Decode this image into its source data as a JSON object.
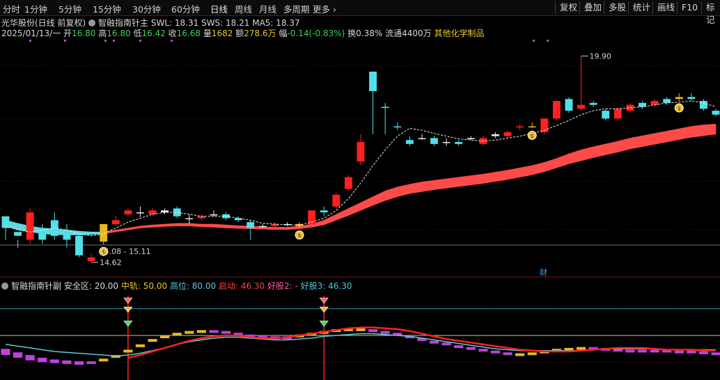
{
  "toolbar": {
    "periods": [
      "分时",
      "1分钟",
      "5分钟",
      "15分钟",
      "30分钟",
      "60分钟",
      "日线",
      "周线",
      "月线",
      "多周期",
      "更多"
    ],
    "active_period": "日线",
    "right_buttons": [
      "复权",
      "叠加",
      "多股",
      "统计",
      "画线",
      "F10",
      "标记"
    ]
  },
  "header": {
    "stock_name": "光华股份(日线 前复权)",
    "indicator_name": "智融指南针主",
    "swl": "SWL: 18.31",
    "sws": "SWS: 18.21",
    "ma5": "MA5: 18.37",
    "date": "2025/01/13/一",
    "open_label": "开",
    "open": "16.80",
    "high_label": "高",
    "high": "16.80",
    "low_label": "低",
    "low": "16.42",
    "close_label": "收",
    "close": "16.68",
    "volume_label": "量",
    "volume": "1682",
    "amount_label": "额",
    "amount": "278.6万",
    "change_label": "幅",
    "change": "-0.14(-0.83%)",
    "turnover": "换0.38%",
    "float_shares": "流通4400万",
    "industry": "其他化学制品"
  },
  "sub_header": {
    "indicator_name": "智融指南针副",
    "safe_zone": "安全区: 20.00",
    "mid_rail": "中轨: 50.00",
    "high_pos": "高位: 80.00",
    "start": "启动: 46.30",
    "good1": "好股2: -",
    "good2": "好股3: 46.30"
  },
  "annotations": {
    "high_marker": "19.90",
    "low_marker": "14.62",
    "range_label": "15.08 - 15.11",
    "finance_tag": "财"
  },
  "colors": {
    "up": "#ff2020",
    "down": "#4fe0e8",
    "band_up": "#ff4a4a",
    "band_down": "#5fd8e0",
    "gold": "#e8b820",
    "purple": "#c040e0",
    "background": "#000000"
  },
  "chart_data": [
    {
      "type": "candlestick",
      "ylim": [
        14.3,
        20.3
      ],
      "candles": [
        [
          15.5,
          15.8,
          15.2,
          15.6,
          "down"
        ],
        [
          15.4,
          15.3,
          15.0,
          15.2,
          "down"
        ],
        [
          15.9,
          15.2,
          15.1,
          16.0,
          "up"
        ],
        [
          15.5,
          15.2,
          15.1,
          15.6,
          "down"
        ],
        [
          15.7,
          15.3,
          15.2,
          15.9,
          "down"
        ],
        [
          15.4,
          15.2,
          15.0,
          15.6,
          "down"
        ],
        [
          15.3,
          14.8,
          14.75,
          15.35,
          "down"
        ],
        [
          14.75,
          14.65,
          14.62,
          14.85,
          "up"
        ],
        [
          15.15,
          15.6,
          15.08,
          15.6,
          "up"
        ],
        [
          15.6,
          15.7,
          15.55,
          15.8,
          "up"
        ],
        [
          15.85,
          15.95,
          15.8,
          16.0,
          "up"
        ],
        [
          15.88,
          15.9,
          15.78,
          16.05,
          "flat"
        ],
        [
          15.95,
          15.85,
          15.8,
          16.0,
          "up"
        ],
        [
          15.95,
          15.9,
          15.85,
          16.0,
          "flat"
        ],
        [
          16.0,
          15.8,
          15.75,
          16.05,
          "down"
        ],
        [
          15.75,
          15.75,
          15.6,
          15.85,
          "flat"
        ],
        [
          15.8,
          15.75,
          15.7,
          15.85,
          "up"
        ],
        [
          15.85,
          15.85,
          15.8,
          15.95,
          "flat"
        ],
        [
          15.85,
          15.75,
          15.7,
          15.9,
          "down"
        ],
        [
          15.75,
          15.7,
          15.65,
          15.8,
          "down"
        ],
        [
          15.65,
          15.5,
          15.2,
          15.7,
          "down"
        ],
        [
          15.55,
          15.55,
          15.5,
          15.6,
          "flat"
        ],
        [
          15.55,
          15.6,
          15.5,
          15.65,
          "up"
        ],
        [
          15.6,
          15.6,
          15.55,
          15.65,
          "flat"
        ],
        [
          15.6,
          15.55,
          15.5,
          15.65,
          "flat"
        ],
        [
          15.6,
          15.95,
          15.5,
          15.95,
          "up"
        ],
        [
          15.9,
          15.95,
          15.8,
          16.05,
          "down"
        ],
        [
          16.05,
          16.35,
          16.0,
          16.4,
          "up"
        ],
        [
          16.5,
          16.8,
          16.45,
          16.85,
          "up"
        ],
        [
          17.2,
          17.7,
          17.1,
          17.9,
          "up"
        ],
        [
          19.0,
          19.5,
          17.9,
          19.5,
          "down"
        ],
        [
          18.6,
          18.6,
          17.9,
          18.7,
          "down"
        ],
        [
          18.1,
          18.1,
          18.0,
          18.2,
          "down"
        ],
        [
          17.75,
          17.65,
          17.6,
          17.85,
          "down"
        ],
        [
          17.8,
          17.8,
          17.75,
          17.9,
          "flat"
        ],
        [
          17.8,
          17.65,
          17.6,
          17.85,
          "down"
        ],
        [
          17.7,
          17.7,
          17.6,
          17.8,
          "flat"
        ],
        [
          17.7,
          17.65,
          17.6,
          17.75,
          "down"
        ],
        [
          17.8,
          17.8,
          17.75,
          17.85,
          "flat"
        ],
        [
          17.65,
          17.8,
          17.6,
          17.85,
          "up"
        ],
        [
          17.85,
          17.9,
          17.8,
          17.95,
          "flat"
        ],
        [
          17.85,
          17.95,
          17.8,
          18.0,
          "up"
        ],
        [
          18.1,
          18.1,
          18.0,
          18.15,
          "up"
        ],
        [
          18.1,
          18.1,
          18.05,
          18.2,
          "flat"
        ],
        [
          17.95,
          18.3,
          17.9,
          18.3,
          "up"
        ],
        [
          18.3,
          18.75,
          18.25,
          18.75,
          "up"
        ],
        [
          18.8,
          18.5,
          18.45,
          18.85,
          "down"
        ],
        [
          18.55,
          18.65,
          18.5,
          19.9,
          "up"
        ],
        [
          18.65,
          18.7,
          18.6,
          18.75,
          "down"
        ],
        [
          18.5,
          18.3,
          18.25,
          18.55,
          "down"
        ],
        [
          18.3,
          18.55,
          18.25,
          18.55,
          "up"
        ],
        [
          18.5,
          18.65,
          18.45,
          18.7,
          "up"
        ],
        [
          18.7,
          18.6,
          18.55,
          18.75,
          "down"
        ],
        [
          18.65,
          18.75,
          18.6,
          18.8,
          "up"
        ],
        [
          18.8,
          18.7,
          18.65,
          18.85,
          "down"
        ],
        [
          18.8,
          18.85,
          18.75,
          18.95,
          "up"
        ],
        [
          18.85,
          18.8,
          18.75,
          18.95,
          "down"
        ],
        [
          18.75,
          18.55,
          18.5,
          18.8,
          "down"
        ],
        [
          18.5,
          18.4,
          18.35,
          18.55,
          "down"
        ]
      ],
      "ma5": [
        15.55,
        15.45,
        15.4,
        15.45,
        15.5,
        15.45,
        15.35,
        15.3,
        15.35,
        15.5,
        15.65,
        15.75,
        15.85,
        15.9,
        15.9,
        15.85,
        15.8,
        15.8,
        15.8,
        15.75,
        15.7,
        15.62,
        15.6,
        15.58,
        15.58,
        15.65,
        15.75,
        15.95,
        16.25,
        16.65,
        17.1,
        17.5,
        17.85,
        18.05,
        18.0,
        17.92,
        17.85,
        17.78,
        17.75,
        17.72,
        17.75,
        17.8,
        17.85,
        17.92,
        18.0,
        18.12,
        18.25,
        18.4,
        18.5,
        18.55,
        18.55,
        18.58,
        18.6,
        18.65,
        18.7,
        18.72,
        18.75,
        18.7,
        18.6
      ],
      "band_upper": [
        15.7,
        15.62,
        15.55,
        15.5,
        15.48,
        15.45,
        15.42,
        15.4,
        15.4,
        15.45,
        15.5,
        15.55,
        15.58,
        15.6,
        15.62,
        15.62,
        15.6,
        15.6,
        15.58,
        15.56,
        15.55,
        15.53,
        15.52,
        15.52,
        15.55,
        15.6,
        15.7,
        15.85,
        16.0,
        16.15,
        16.3,
        16.45,
        16.55,
        16.62,
        16.68,
        16.72,
        16.76,
        16.8,
        16.84,
        16.88,
        16.93,
        16.98,
        17.04,
        17.1,
        17.18,
        17.28,
        17.4,
        17.5,
        17.58,
        17.65,
        17.72,
        17.8,
        17.86,
        17.92,
        17.98,
        18.04,
        18.1,
        18.14,
        18.16
      ],
      "band_lower": [
        15.55,
        15.45,
        15.4,
        15.35,
        15.33,
        15.32,
        15.32,
        15.33,
        15.35,
        15.4,
        15.45,
        15.5,
        15.52,
        15.54,
        15.55,
        15.55,
        15.53,
        15.52,
        15.5,
        15.49,
        15.48,
        15.47,
        15.46,
        15.46,
        15.48,
        15.52,
        15.58,
        15.7,
        15.82,
        15.95,
        16.08,
        16.2,
        16.3,
        16.38,
        16.43,
        16.48,
        16.52,
        16.56,
        16.6,
        16.64,
        16.69,
        16.74,
        16.8,
        16.86,
        16.94,
        17.04,
        17.14,
        17.22,
        17.3,
        17.37,
        17.44,
        17.52,
        17.58,
        17.64,
        17.7,
        17.76,
        17.82,
        17.86,
        17.9
      ],
      "band_trend": [
        "down",
        "down",
        "down",
        "down",
        "down",
        "down",
        "down",
        "down",
        "up",
        "up",
        "up",
        "up",
        "up",
        "up",
        "up",
        "up",
        "up",
        "up",
        "up",
        "up",
        "up",
        "up",
        "up",
        "up",
        "up",
        "up",
        "up",
        "up",
        "up",
        "up",
        "up",
        "up",
        "up",
        "up",
        "up",
        "up",
        "up",
        "up",
        "up",
        "up",
        "up",
        "up",
        "up",
        "up",
        "up",
        "up",
        "up",
        "up",
        "up",
        "up",
        "up",
        "up",
        "up",
        "up",
        "up",
        "up",
        "up",
        "up",
        "up"
      ],
      "signals": [
        8,
        24,
        43,
        55
      ]
    },
    {
      "type": "line",
      "title": "智融指南针副",
      "ylim": [
        0,
        100
      ],
      "levels": {
        "safe_zone": 20,
        "mid_rail": 50,
        "high_pos": 80
      },
      "red_line": [
        null,
        null,
        null,
        null,
        null,
        null,
        null,
        null,
        null,
        null,
        25,
        28,
        32,
        36,
        40,
        44,
        47,
        49,
        50,
        50,
        48,
        47,
        47,
        48,
        50,
        52,
        54,
        56,
        58,
        59,
        59,
        58,
        57,
        55,
        52,
        49,
        46,
        44,
        42,
        40,
        38,
        36,
        34,
        33,
        32,
        32,
        32,
        33,
        34,
        35,
        36,
        36,
        36,
        35,
        34,
        34,
        34,
        33,
        33
      ],
      "cyan_line": [
        40,
        38,
        36,
        34,
        32,
        31,
        30,
        29,
        28,
        27,
        28,
        30,
        33,
        36,
        40,
        43,
        45,
        47,
        48,
        48,
        47,
        46,
        45,
        45,
        46,
        47,
        49,
        50,
        51,
        52,
        52,
        51,
        50,
        49,
        47,
        45,
        43,
        41,
        39,
        37,
        35,
        34,
        33,
        33,
        33,
        33,
        33,
        33,
        34,
        35,
        35,
        35,
        35,
        35,
        34,
        34,
        34,
        34,
        34
      ],
      "blocks": [
        [
          35,
          28
        ],
        [
          31,
          25
        ],
        [
          28,
          22
        ],
        [
          25,
          20
        ],
        [
          23,
          19
        ],
        [
          22,
          18
        ],
        [
          21,
          17
        ],
        [
          21,
          18
        ],
        [
          24,
          22
        ],
        [
          28,
          26
        ],
        [
          34,
          32
        ],
        [
          40,
          38
        ],
        [
          46,
          44
        ],
        [
          50,
          48
        ],
        [
          53,
          51
        ],
        [
          55,
          53
        ],
        [
          56,
          54
        ],
        [
          56,
          54
        ],
        [
          55,
          53
        ],
        [
          53,
          51
        ],
        [
          51,
          49
        ],
        [
          50,
          48
        ],
        [
          49,
          47
        ],
        [
          49,
          47
        ],
        [
          51,
          49
        ],
        [
          53,
          51
        ],
        [
          55,
          53
        ],
        [
          57,
          55
        ],
        [
          58,
          56
        ],
        [
          58,
          56
        ],
        [
          57,
          55
        ],
        [
          55,
          53
        ],
        [
          53,
          51
        ],
        [
          50,
          48
        ],
        [
          47,
          45
        ],
        [
          44,
          42
        ],
        [
          42,
          40
        ],
        [
          39,
          37
        ],
        [
          37,
          35
        ],
        [
          35,
          33
        ],
        [
          33,
          31
        ],
        [
          31,
          29
        ],
        [
          30,
          28
        ],
        [
          31,
          29
        ],
        [
          33,
          31
        ],
        [
          35,
          33
        ],
        [
          36,
          34
        ],
        [
          37,
          35
        ],
        [
          37,
          35
        ],
        [
          36,
          34
        ],
        [
          35,
          33
        ],
        [
          34,
          32
        ],
        [
          34,
          32
        ],
        [
          34,
          32
        ],
        [
          34,
          32
        ],
        [
          33,
          31
        ],
        [
          33,
          31
        ],
        [
          32,
          30
        ],
        [
          31,
          29
        ]
      ],
      "block_trend": [
        "down",
        "down",
        "down",
        "down",
        "down",
        "down",
        "down",
        "down",
        "up",
        "up",
        "up",
        "up",
        "up",
        "up",
        "up",
        "up",
        "up",
        "down",
        "down",
        "down",
        "down",
        "down",
        "down",
        "down",
        "up",
        "up",
        "up",
        "up",
        "up",
        "up",
        "down",
        "down",
        "down",
        "down",
        "down",
        "down",
        "down",
        "down",
        "down",
        "down",
        "down",
        "down",
        "up",
        "up",
        "up",
        "up",
        "up",
        "up",
        "down",
        "down",
        "down",
        "down",
        "down",
        "down",
        "down",
        "down",
        "down",
        "down",
        "down"
      ],
      "signal_bars": [
        10,
        26
      ]
    }
  ]
}
